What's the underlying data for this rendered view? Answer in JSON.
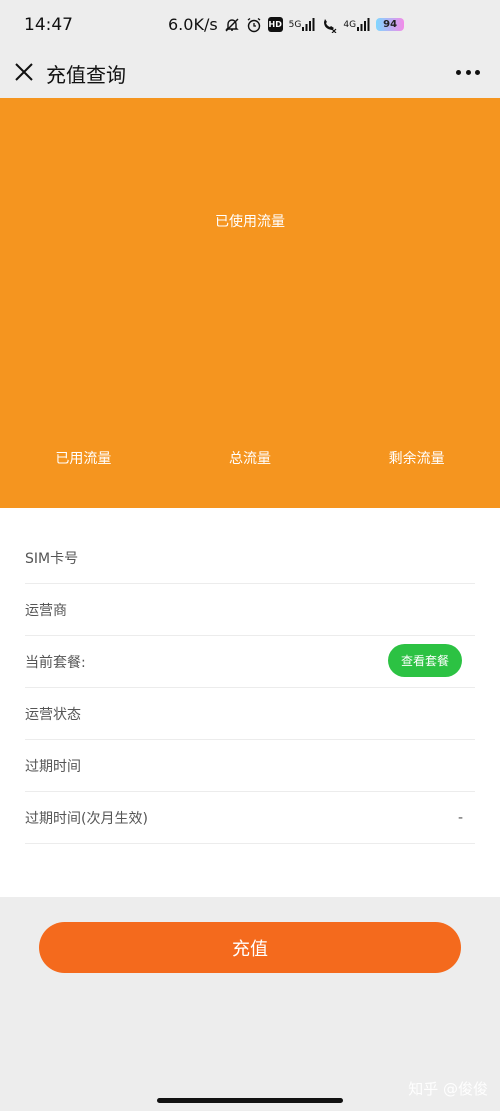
{
  "status_bar": {
    "time": "14:47",
    "speed": "6.0K/s",
    "hd_label": "HD",
    "signal1": "5G",
    "signal2": "4G",
    "battery": "94"
  },
  "nav": {
    "title": "充值查询"
  },
  "hero": {
    "caption": "已使用流量",
    "stats": [
      "已用流量",
      "总流量",
      "剩余流量"
    ]
  },
  "info": {
    "sim_label": "SIM卡号",
    "carrier_label": "运营商",
    "plan_label": "当前套餐:",
    "view_plan_button": "查看套餐",
    "status_label": "运营状态",
    "expiry_label": "过期时间",
    "expiry_next_label": "过期时间(次月生效)",
    "expiry_next_value": "-"
  },
  "actions": {
    "recharge_button": "充值"
  },
  "watermark": "知乎 @俊俊",
  "colors": {
    "hero_bg": "#f5951f",
    "recharge_bg": "#f46a1d",
    "view_plan_bg": "#2cc243"
  }
}
